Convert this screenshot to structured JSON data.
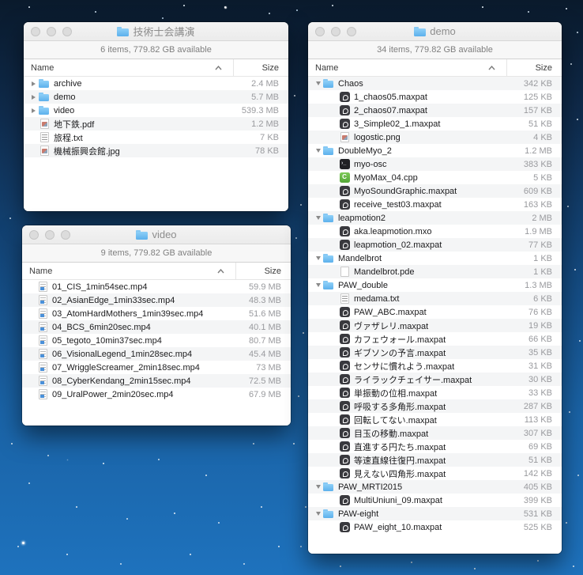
{
  "desktop": {
    "wallpaper_top_color": "#0a1a2c",
    "wallpaper_bottom_color": "#1e72bd"
  },
  "columns": {
    "name": "Name",
    "size": "Size"
  },
  "windows": [
    {
      "title": "技術士会講演",
      "status": "6 items, 779.82 GB available",
      "columns": {
        "name": "Name",
        "size": "Size"
      },
      "rows": [
        {
          "name": "archive",
          "size": "2.4 MB",
          "icon": "folder",
          "level": 0,
          "disclosure": "collapsed"
        },
        {
          "name": "demo",
          "size": "5.7 MB",
          "icon": "folder",
          "level": 0,
          "disclosure": "collapsed"
        },
        {
          "name": "video",
          "size": "539.3 MB",
          "icon": "folder",
          "level": 0,
          "disclosure": "collapsed"
        },
        {
          "name": "地下鉄.pdf",
          "size": "1.2 MB",
          "icon": "image",
          "level": 0,
          "disclosure": null
        },
        {
          "name": "旅程.txt",
          "size": "7 KB",
          "icon": "txt",
          "level": 0,
          "disclosure": null
        },
        {
          "name": "機械振興会館.jpg",
          "size": "78 KB",
          "icon": "image",
          "level": 0,
          "disclosure": null
        }
      ]
    },
    {
      "title": "video",
      "status": "9 items, 779.82 GB available",
      "columns": {
        "name": "Name",
        "size": "Size"
      },
      "rows": [
        {
          "name": "01_CIS_1min54sec.mp4",
          "size": "59.9 MB",
          "icon": "mp4",
          "level": 0,
          "disclosure": null
        },
        {
          "name": "02_AsianEdge_1min33sec.mp4",
          "size": "48.3 MB",
          "icon": "mp4",
          "level": 0,
          "disclosure": null
        },
        {
          "name": "03_AtomHardMothers_1min39sec.mp4",
          "size": "51.6 MB",
          "icon": "mp4",
          "level": 0,
          "disclosure": null
        },
        {
          "name": "04_BCS_6min20sec.mp4",
          "size": "40.1 MB",
          "icon": "mp4",
          "level": 0,
          "disclosure": null
        },
        {
          "name": "05_tegoto_10min37sec.mp4",
          "size": "80.7 MB",
          "icon": "mp4",
          "level": 0,
          "disclosure": null
        },
        {
          "name": "06_VisionalLegend_1min28sec.mp4",
          "size": "45.4 MB",
          "icon": "mp4",
          "level": 0,
          "disclosure": null
        },
        {
          "name": "07_WriggleScreamer_2min18sec.mp4",
          "size": "73 MB",
          "icon": "mp4",
          "level": 0,
          "disclosure": null
        },
        {
          "name": "08_CyberKendang_2min15sec.mp4",
          "size": "72.5 MB",
          "icon": "mp4",
          "level": 0,
          "disclosure": null
        },
        {
          "name": "09_UralPower_2min20sec.mp4",
          "size": "67.9 MB",
          "icon": "mp4",
          "level": 0,
          "disclosure": null
        }
      ]
    },
    {
      "title": "demo",
      "status": "34 items, 779.82 GB available",
      "columns": {
        "name": "Name",
        "size": "Size"
      },
      "rows": [
        {
          "name": "Chaos",
          "size": "342 KB",
          "icon": "folder",
          "level": 0,
          "disclosure": "expanded"
        },
        {
          "name": "1_chaos05.maxpat",
          "size": "125 KB",
          "icon": "maxpat",
          "level": 1,
          "disclosure": null
        },
        {
          "name": "2_chaos07.maxpat",
          "size": "157 KB",
          "icon": "maxpat",
          "level": 1,
          "disclosure": null
        },
        {
          "name": "3_Simple02_1.maxpat",
          "size": "51 KB",
          "icon": "maxpat",
          "level": 1,
          "disclosure": null
        },
        {
          "name": "logostic.png",
          "size": "4 KB",
          "icon": "image",
          "level": 1,
          "disclosure": null
        },
        {
          "name": "DoubleMyo_2",
          "size": "1.2 MB",
          "icon": "folder",
          "level": 0,
          "disclosure": "expanded"
        },
        {
          "name": "myo-osc",
          "size": "383 KB",
          "icon": "exec",
          "level": 1,
          "disclosure": null
        },
        {
          "name": "MyoMax_04.cpp",
          "size": "5 KB",
          "icon": "cpp",
          "level": 1,
          "disclosure": null
        },
        {
          "name": "MyoSoundGraphic.maxpat",
          "size": "609 KB",
          "icon": "maxpat",
          "level": 1,
          "disclosure": null
        },
        {
          "name": "receive_test03.maxpat",
          "size": "163 KB",
          "icon": "maxpat",
          "level": 1,
          "disclosure": null
        },
        {
          "name": "leapmotion2",
          "size": "2 MB",
          "icon": "folder",
          "level": 0,
          "disclosure": "expanded"
        },
        {
          "name": "aka.leapmotion.mxo",
          "size": "1.9 MB",
          "icon": "maxpat",
          "level": 1,
          "disclosure": null
        },
        {
          "name": "leapmotion_02.maxpat",
          "size": "77 KB",
          "icon": "maxpat",
          "level": 1,
          "disclosure": null
        },
        {
          "name": "Mandelbrot",
          "size": "1 KB",
          "icon": "folder",
          "level": 0,
          "disclosure": "expanded"
        },
        {
          "name": "Mandelbrot.pde",
          "size": "1 KB",
          "icon": "page",
          "level": 1,
          "disclosure": null
        },
        {
          "name": "PAW_double",
          "size": "1.3 MB",
          "icon": "folder",
          "level": 0,
          "disclosure": "expanded"
        },
        {
          "name": "medama.txt",
          "size": "6 KB",
          "icon": "txt",
          "level": 1,
          "disclosure": null
        },
        {
          "name": "PAW_ABC.maxpat",
          "size": "76 KB",
          "icon": "maxpat",
          "level": 1,
          "disclosure": null
        },
        {
          "name": "ヴァザレリ.maxpat",
          "size": "19 KB",
          "icon": "maxpat",
          "level": 1,
          "disclosure": null
        },
        {
          "name": "カフェウォール.maxpat",
          "size": "66 KB",
          "icon": "maxpat",
          "level": 1,
          "disclosure": null
        },
        {
          "name": "ギブソンの予言.maxpat",
          "size": "35 KB",
          "icon": "maxpat",
          "level": 1,
          "disclosure": null
        },
        {
          "name": "センサに慣れよう.maxpat",
          "size": "31 KB",
          "icon": "maxpat",
          "level": 1,
          "disclosure": null
        },
        {
          "name": "ライラックチェイサー.maxpat",
          "size": "30 KB",
          "icon": "maxpat",
          "level": 1,
          "disclosure": null
        },
        {
          "name": "単振動の位相.maxpat",
          "size": "33 KB",
          "icon": "maxpat",
          "level": 1,
          "disclosure": null
        },
        {
          "name": "呼吸する多角形.maxpat",
          "size": "287 KB",
          "icon": "maxpat",
          "level": 1,
          "disclosure": null
        },
        {
          "name": "回転してない.maxpat",
          "size": "113 KB",
          "icon": "maxpat",
          "level": 1,
          "disclosure": null
        },
        {
          "name": "目玉の移動.maxpat",
          "size": "307 KB",
          "icon": "maxpat",
          "level": 1,
          "disclosure": null
        },
        {
          "name": "直進する円たち.maxpat",
          "size": "69 KB",
          "icon": "maxpat",
          "level": 1,
          "disclosure": null
        },
        {
          "name": "等速直線往復円.maxpat",
          "size": "51 KB",
          "icon": "maxpat",
          "level": 1,
          "disclosure": null
        },
        {
          "name": "見えない四角形.maxpat",
          "size": "142 KB",
          "icon": "maxpat",
          "level": 1,
          "disclosure": null
        },
        {
          "name": "PAW_MRTI2015",
          "size": "405 KB",
          "icon": "folder",
          "level": 0,
          "disclosure": "expanded"
        },
        {
          "name": "MultiUniuni_09.maxpat",
          "size": "399 KB",
          "icon": "maxpat",
          "level": 1,
          "disclosure": null
        },
        {
          "name": "PAW-eight",
          "size": "531 KB",
          "icon": "folder",
          "level": 0,
          "disclosure": "expanded"
        },
        {
          "name": "PAW_eight_10.maxpat",
          "size": "525 KB",
          "icon": "maxpat",
          "level": 1,
          "disclosure": null
        }
      ]
    }
  ]
}
